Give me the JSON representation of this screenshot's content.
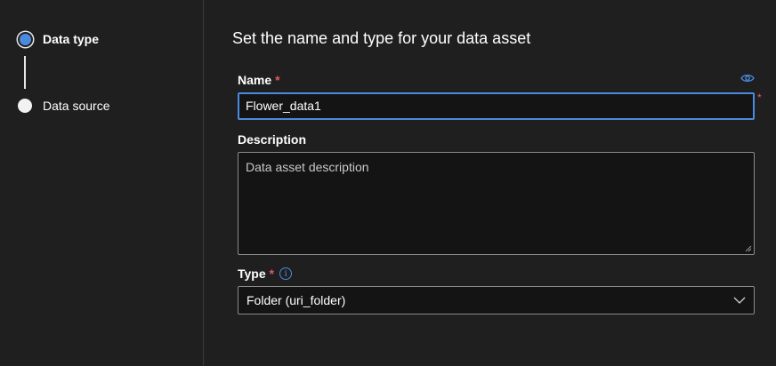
{
  "steps": [
    {
      "label": "Data type",
      "active": true
    },
    {
      "label": "Data source",
      "active": false
    }
  ],
  "form": {
    "heading": "Set the name and type for your data asset",
    "name": {
      "label": "Name",
      "required_mark": "*",
      "value": "Flower_data1"
    },
    "description": {
      "label": "Description",
      "placeholder": "Data asset description",
      "value": ""
    },
    "type": {
      "label": "Type",
      "required_mark": "*",
      "info_glyph": "i",
      "selected": "Folder (uri_folder)"
    }
  },
  "colors": {
    "accent": "#4a8be0",
    "required": "#e4565e",
    "background": "#1f1f1f"
  },
  "icons": {
    "eye": "eye-icon",
    "info": "info-icon",
    "chevron": "chevron-down-icon"
  }
}
